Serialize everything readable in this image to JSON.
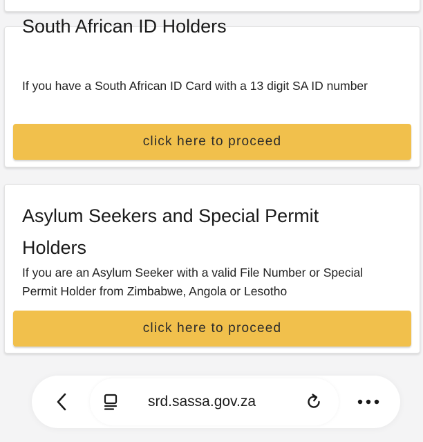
{
  "cards": [
    {
      "title": "South African ID Holders",
      "description": "If you have a South African ID Card with a 13 digit SA ID number",
      "button_label": "click here to proceed"
    },
    {
      "title": "Asylum Seekers and Special Permit Holders",
      "description": "If you are an Asylum Seeker with a valid File Number or Special Permit Holder from Zimbabwe, Angola or Lesotho",
      "button_label": "click here to proceed"
    }
  ],
  "browser": {
    "url": "srd.sassa.gov.za",
    "icons": {
      "back": "chevron-left-icon",
      "reader": "reader-mode-icon",
      "reload": "reload-icon",
      "more": "more-options-icon"
    }
  },
  "colors": {
    "button_background": "#f1c04c",
    "card_background": "#ffffff",
    "page_background": "#f4f4f5"
  }
}
